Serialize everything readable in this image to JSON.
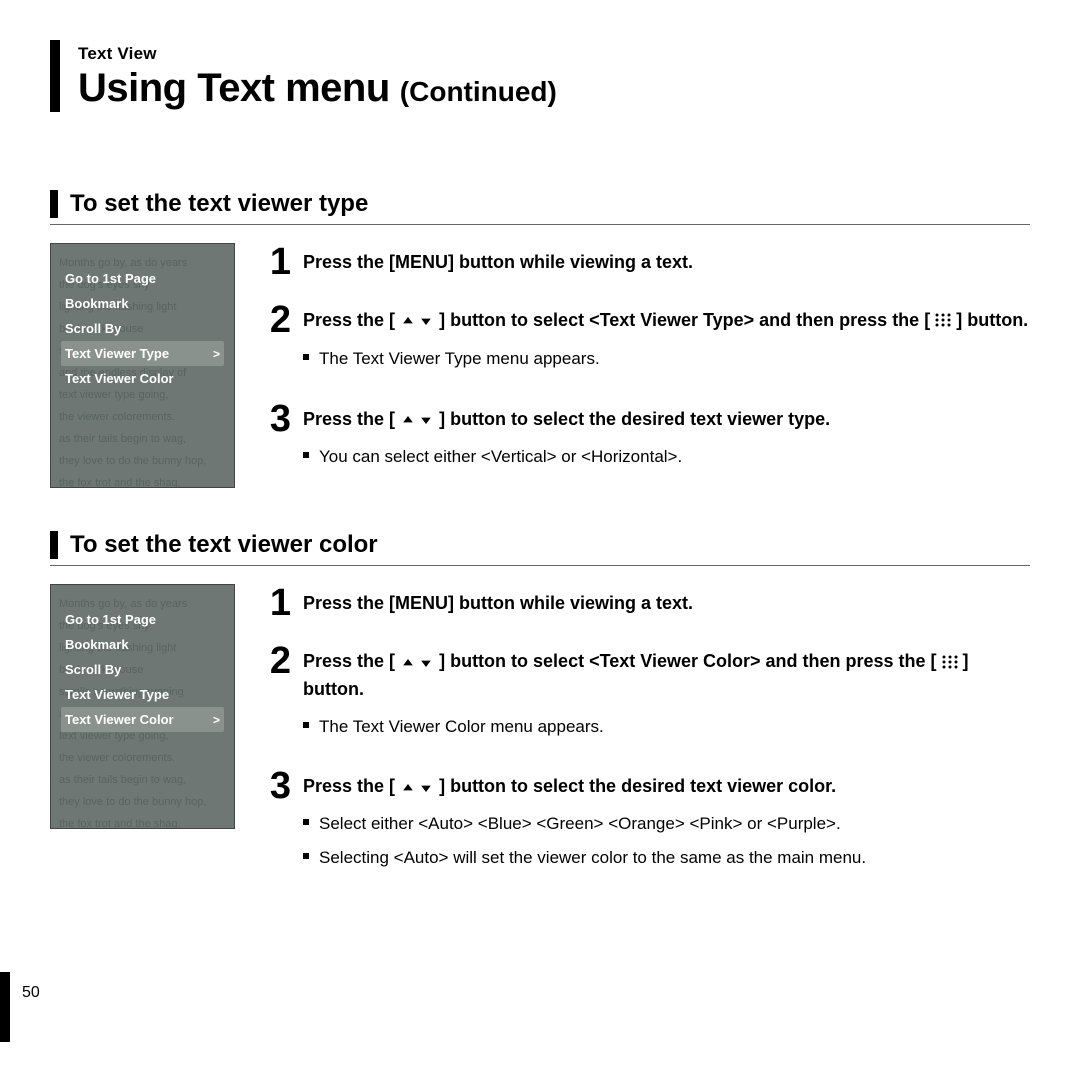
{
  "header": {
    "eyebrow": "Text View",
    "title_main": "Using Text menu",
    "title_cont": "(Continued)"
  },
  "section1": {
    "title": "To set the text viewer type",
    "menu": {
      "items": [
        "Go to 1st Page",
        "Bookmark",
        "Scroll By",
        "Text Viewer Type",
        "Text Viewer Color"
      ],
      "selected_index": 3,
      "bg_lines": "Months go by, as do years\nthe dog's eyes shy\nlighting the flashing light\nbookmark mouse\nscrolls something running\nand the endless display of\ntext viewer type going,\nthe viewer colorements.\nas their tails begin to wag,\nthey love to do the bunny hop,\nthe fox trot and the shag,\nyou'll see the doghouse rockin'\nas a hundred dogs or more\nall trip the light fantastic"
    },
    "steps": {
      "s1": {
        "heading": "Press the [MENU] button while viewing a text."
      },
      "s2": {
        "heading_a": "Press the [",
        "heading_b": "] button to select <Text Viewer Type> and then press the [",
        "heading_c": "] button.",
        "note1": "The Text Viewer Type menu appears."
      },
      "s3": {
        "heading_a": "Press the [",
        "heading_b": "] button to select the desired text viewer type.",
        "note1": "You can select either <Vertical> or <Horizontal>."
      }
    }
  },
  "section2": {
    "title": "To set the text viewer color",
    "menu": {
      "items": [
        "Go to 1st Page",
        "Bookmark",
        "Scroll By",
        "Text Viewer Type",
        "Text Viewer Color"
      ],
      "selected_index": 4,
      "bg_lines": "Months go by, as do years\nthe dog's eyes shy\nlighting the flashing light\nbookmark mouse\nscrolls something running\nand the endless display of\ntext viewer type going,\nthe viewer colorements.\nas their tails begin to wag,\nthey love to do the bunny hop,\nthe fox trot and the shag,\nyou'll see the doghouse rockin'\nas a hundred dogs or more\nall trip the light fantastic"
    },
    "steps": {
      "s1": {
        "heading": "Press the [MENU] button while viewing a text."
      },
      "s2": {
        "heading_a": "Press the [",
        "heading_b": "] button to select <Text Viewer Color> and then press the [",
        "heading_c": "] button.",
        "note1": "The Text Viewer Color menu appears."
      },
      "s3": {
        "heading_a": "Press the [",
        "heading_b": "] button to select the desired text viewer color.",
        "note1": "Select either <Auto> <Blue> <Green> <Orange> <Pink> or <Purple>.",
        "note2": "Selecting <Auto> will set the viewer color to the same as the main menu."
      }
    }
  },
  "page_number": "50",
  "glyphs": {
    "chevron": ">"
  }
}
